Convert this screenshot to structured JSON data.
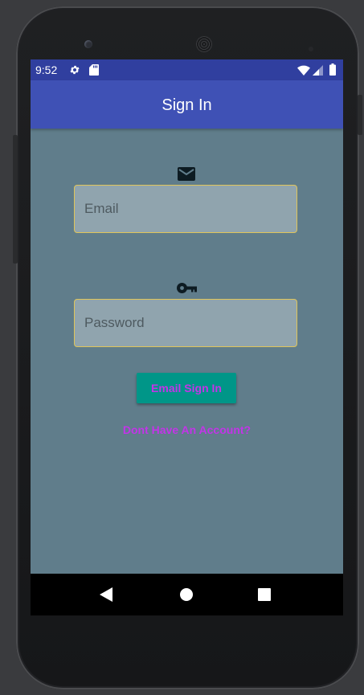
{
  "status_bar": {
    "time": "9:52",
    "icons": [
      "gear-icon",
      "sd-card-icon",
      "wifi-icon",
      "cell-signal-icon",
      "battery-icon"
    ]
  },
  "app_bar": {
    "title": "Sign In"
  },
  "form": {
    "email_icon": "email-icon",
    "email_value": "",
    "email_placeholder": "Email",
    "password_icon": "key-icon",
    "password_value": "",
    "password_placeholder": "Password",
    "signin_label": "Email Sign In",
    "signup_link": "Dont Have An Account?"
  },
  "nav_bar": {
    "icons": [
      "back-icon",
      "home-icon",
      "recents-icon"
    ]
  },
  "colors": {
    "status_bar": "#303f9f",
    "app_bar": "#3f51b5",
    "background": "#607d8b",
    "field_background": "#90a4ae",
    "field_border": "#e0c55a",
    "button": "#009688",
    "accent_text": "#c334e8"
  }
}
